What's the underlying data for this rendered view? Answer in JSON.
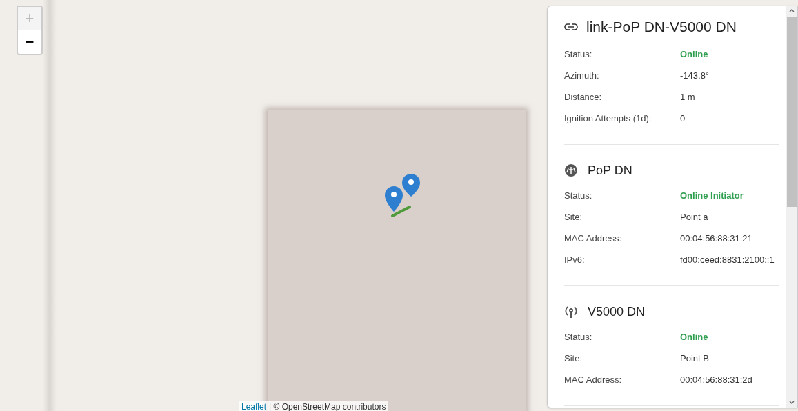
{
  "zoom_controls": [
    {
      "label": "+",
      "disabled": true
    },
    {
      "label": "−",
      "disabled": false
    }
  ],
  "attribution": {
    "link": "Leaflet",
    "text": "| © OpenStreetMap contributors"
  },
  "panel": {
    "title": "link-PoP DN-V5000 DN",
    "rows": [
      {
        "label": "Status:",
        "value": "Online",
        "kind": "status"
      },
      {
        "label": "Azimuth:",
        "value": "-143.8°",
        "kind": "plain"
      },
      {
        "label": "Distance:",
        "value": "1 m",
        "kind": "plain"
      },
      {
        "label": "Ignition Attempts (1d):",
        "value": "0",
        "kind": "plain"
      }
    ],
    "sections": [
      {
        "kind": "pop",
        "title": "PoP DN",
        "rows": [
          {
            "label": "Status:",
            "value": "Online Initiator",
            "kind": "status"
          },
          {
            "label": "Site:",
            "value": "Point a",
            "kind": "plain"
          },
          {
            "label": "MAC Address:",
            "value": "00:04:56:88:31:21",
            "kind": "plain"
          },
          {
            "label": "IPv6:",
            "value": "fd00:ceed:8831:2100::1",
            "kind": "plain"
          }
        ]
      },
      {
        "kind": "dn",
        "title": "V5000 DN",
        "rows": [
          {
            "label": "Status:",
            "value": "Online",
            "kind": "status"
          },
          {
            "label": "Site:",
            "value": "Point B",
            "kind": "plain"
          },
          {
            "label": "MAC Address:",
            "value": "00:04:56:88:31:2d",
            "kind": "plain"
          }
        ]
      }
    ]
  }
}
